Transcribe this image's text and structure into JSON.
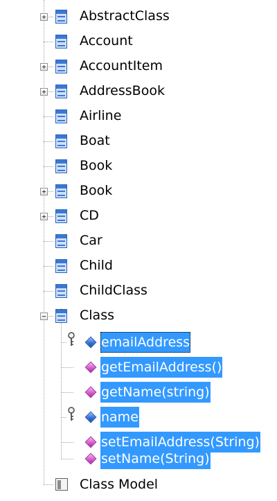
{
  "tree": {
    "items": [
      {
        "label": "AbstractClass",
        "icon": "class-icon",
        "expander": "plus"
      },
      {
        "label": "Account",
        "icon": "class-icon",
        "expander": "none"
      },
      {
        "label": "AccountItem",
        "icon": "class-icon",
        "expander": "plus"
      },
      {
        "label": "AddressBook",
        "icon": "class-icon",
        "expander": "plus"
      },
      {
        "label": "Airline",
        "icon": "class-icon",
        "expander": "none"
      },
      {
        "label": "Boat",
        "icon": "class-icon",
        "expander": "none"
      },
      {
        "label": "Book",
        "icon": "class-icon",
        "expander": "none"
      },
      {
        "label": "Book",
        "icon": "class-icon",
        "expander": "plus"
      },
      {
        "label": "CD",
        "icon": "class-icon",
        "expander": "plus"
      },
      {
        "label": "Car",
        "icon": "class-icon",
        "expander": "none"
      },
      {
        "label": "Child",
        "icon": "class-icon",
        "expander": "none"
      },
      {
        "label": "ChildClass",
        "icon": "class-icon",
        "expander": "none"
      },
      {
        "label": "Class",
        "icon": "class-icon",
        "expander": "minus"
      },
      {
        "label": "Class Model",
        "icon": "model-icon",
        "expander": "none"
      }
    ],
    "members": [
      {
        "label": "emailAddress",
        "icon": "attribute-icon",
        "key": true,
        "selected": true,
        "focused": true
      },
      {
        "label": "getEmailAddress()",
        "icon": "operation-icon",
        "key": false,
        "selected": true,
        "focused": false
      },
      {
        "label": "getName(string)",
        "icon": "operation-icon",
        "key": false,
        "selected": true,
        "focused": false
      },
      {
        "label": "name",
        "icon": "attribute-icon",
        "key": true,
        "selected": true,
        "focused": false
      },
      {
        "label": "setEmailAddress(String)",
        "icon": "operation-icon",
        "key": false,
        "selected": true,
        "focused": false
      },
      {
        "label": "setName(String)",
        "icon": "operation-icon",
        "key": false,
        "selected": true,
        "focused": false
      }
    ]
  },
  "colors": {
    "selection": "#3399ff",
    "class_icon": "#3b78d4",
    "attribute_icon": "#3774d6",
    "operation_icon": "#d561cf"
  }
}
